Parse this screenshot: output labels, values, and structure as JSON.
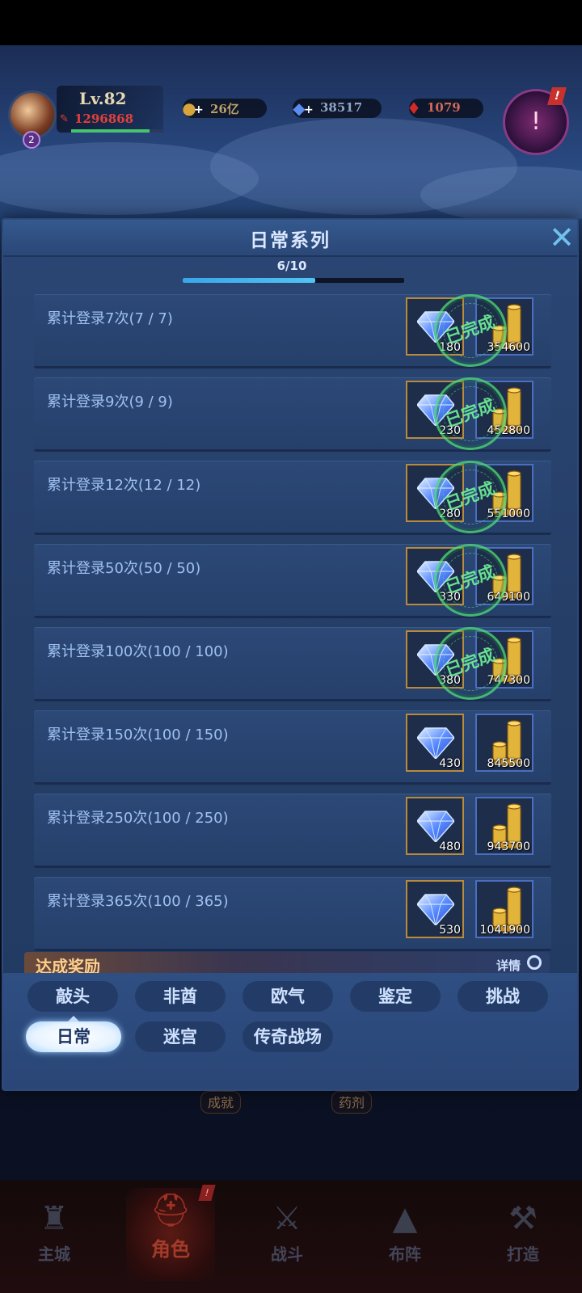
{
  "hud": {
    "level": "Lv.82",
    "power": "1296868",
    "level_progress": 0.85,
    "avatar_badge": "2",
    "gold": "26亿",
    "diamond": "38517",
    "ruby": "1079",
    "plus": "+",
    "quest_alert": "!",
    "quest_icon": "!"
  },
  "dialog": {
    "title": "日常系列",
    "progress_text": "6/10",
    "progress": 0.6,
    "close": "✕"
  },
  "stamp_text": "已完成",
  "tasks": [
    {
      "label": "累计登录7次(7 / 7)",
      "diamond": "180",
      "gold": "354600",
      "completed": true
    },
    {
      "label": "累计登录9次(9 / 9)",
      "diamond": "230",
      "gold": "452800",
      "completed": true
    },
    {
      "label": "累计登录12次(12 / 12)",
      "diamond": "280",
      "gold": "551000",
      "completed": true
    },
    {
      "label": "累计登录50次(50 / 50)",
      "diamond": "330",
      "gold": "649100",
      "completed": true
    },
    {
      "label": "累计登录100次(100 / 100)",
      "diamond": "380",
      "gold": "747300",
      "completed": true
    },
    {
      "label": "累计登录150次(100 / 150)",
      "diamond": "430",
      "gold": "845500",
      "completed": false
    },
    {
      "label": "累计登录250次(100 / 250)",
      "diamond": "480",
      "gold": "943700",
      "completed": false
    },
    {
      "label": "累计登录365次(100 / 365)",
      "diamond": "530",
      "gold": "1041900",
      "completed": false
    }
  ],
  "achievement": {
    "title": "达成奖励",
    "details": "详情"
  },
  "tabs_row1": [
    "敲头",
    "非酋",
    "欧气",
    "鉴定",
    "挑战"
  ],
  "tabs_row2": [
    "日常",
    "迷宫",
    "传奇战场"
  ],
  "background_tags": [
    "成就",
    "药剂"
  ],
  "bottom_nav": [
    {
      "label": "主城",
      "icon": "castle-icon"
    },
    {
      "label": "角色",
      "icon": "helmet-icon"
    },
    {
      "label": "战斗",
      "icon": "swords-icon"
    },
    {
      "label": "布阵",
      "icon": "formation-icon"
    },
    {
      "label": "打造",
      "icon": "anvil-icon"
    }
  ],
  "nav_alert": "!"
}
